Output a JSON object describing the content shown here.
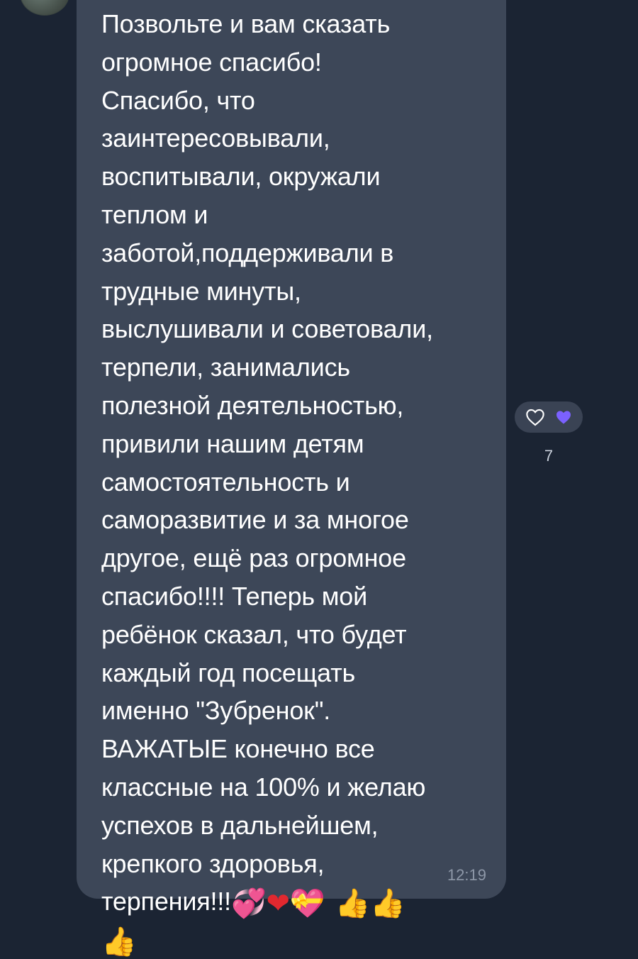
{
  "message": {
    "lines": [
      "Позвольте и вам сказать",
      "огромное спасибо!",
      "Спасибо, что",
      "заинтересовывали,",
      "воспитывали, окружали",
      "теплом и",
      "заботой,поддерживали в",
      "трудные минуты,",
      "выслушивали и советовали,",
      "терпели, занимались",
      "полезной деятельностью,",
      "привили нашим детям",
      "самостоятельность и",
      "саморазвитие и за многое",
      "другое, ещё раз огромное",
      "спасибо!!!! Теперь мой",
      "ребёнок сказал, что будет",
      "каждый год посещать",
      "именно \"Зубренок\".",
      "ВАЖАТЫЕ конечно все",
      "классные на 100% и желаю",
      "успехов в дальнейшем,",
      "крепкого здоровья,",
      "терпения!!!"
    ],
    "emojis": {
      "hearts": "💞",
      "red_heart": "❤",
      "gift_heart": "💝",
      "thumbs_up": "👍"
    },
    "time": "12:19"
  },
  "reactions": {
    "icons": [
      "heart-outline-icon",
      "purple-heart-icon"
    ],
    "colors": {
      "outline": "#ffffff",
      "purple": "#7b61ff"
    },
    "count": "7"
  }
}
